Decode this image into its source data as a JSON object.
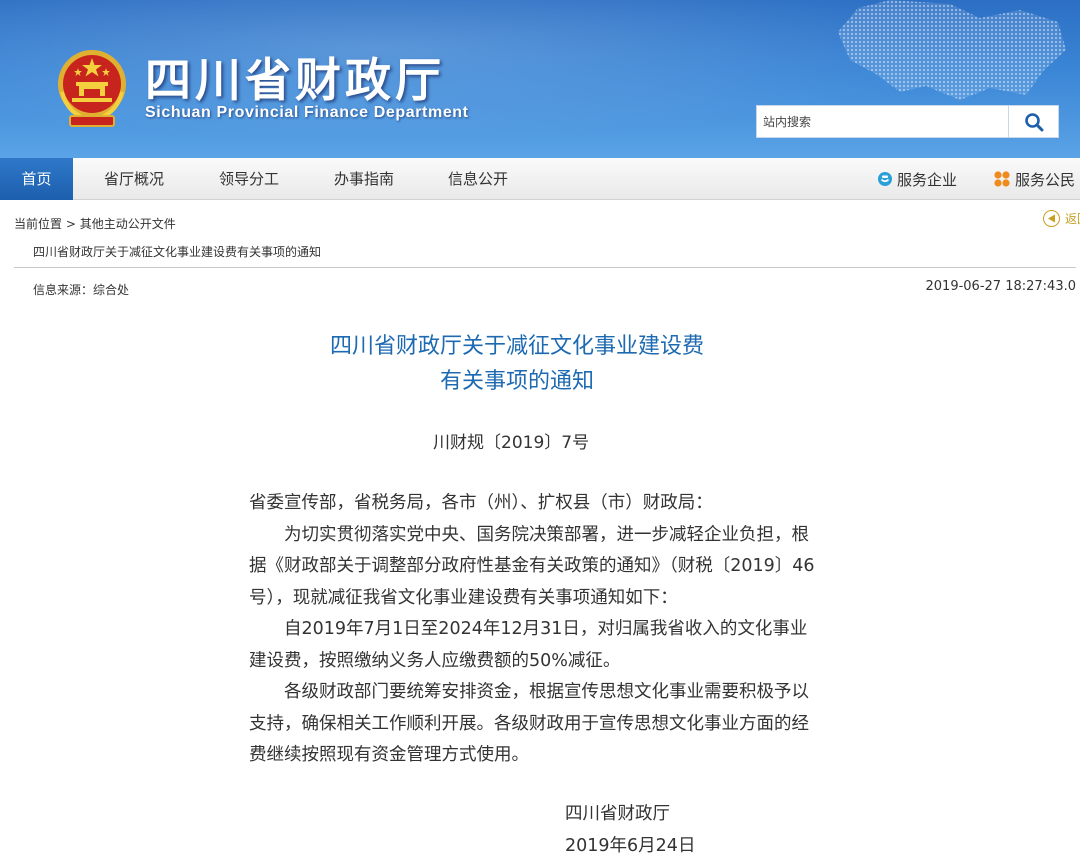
{
  "header": {
    "title_cn": "四川省财政厅",
    "title_en": "Sichuan Provincial Finance Department",
    "emblem_icon": "national-emblem-icon",
    "search_placeholder": "站内搜索",
    "search_icon": "search-icon",
    "colors": {
      "header_blue": "#3b86d6",
      "title_blue": "#1d6ab2",
      "active_nav": "#1d5fae"
    }
  },
  "nav": {
    "items": [
      {
        "label": "首页",
        "active": true
      },
      {
        "label": "省厅概况"
      },
      {
        "label": "领导分工"
      },
      {
        "label": "办事指南"
      },
      {
        "label": "信息公开"
      }
    ],
    "right": [
      {
        "label": "服务企业",
        "icon": "service-enterprise-icon"
      },
      {
        "label": "服务公民",
        "icon": "service-citizen-icon"
      }
    ]
  },
  "breadcrumb": {
    "prefix": "当前位置",
    "sep": ">",
    "item": "其他主动公开文件",
    "back_label": "返回",
    "back_icon": "back-arrow-icon"
  },
  "article": {
    "path_title": "四川省财政厅关于减征文化事业建设费有关事项的通知",
    "source": "信息来源：综合处",
    "date": "2019-06-27 18:27:43.0",
    "title_line1": "四川省财政厅关于减征文化事业建设费",
    "title_line2": "有关事项的通知",
    "doc_number": "川财规〔2019〕7号",
    "addressee": "省委宣传部，省税务局，各市（州）、扩权县（市）财政局：",
    "paragraphs": [
      "为切实贯彻落实党中央、国务院决策部署，进一步减轻企业负担，根据《财政部关于调整部分政府性基金有关政策的通知》（财税〔2019〕46号），现就减征我省文化事业建设费有关事项通知如下：",
      "自2019年7月1日至2024年12月31日，对归属我省收入的文化事业建设费，按照缴纳义务人应缴费额的50%减征。",
      "各级财政部门要统筹安排资金，根据宣传思想文化事业需要积极予以支持，确保相关工作顺利开展。各级财政用于宣传思想文化事业方面的经费继续按照现有资金管理方式使用。"
    ],
    "sign_org": "四川省财政厅",
    "sign_date": "2019年6月24日"
  }
}
